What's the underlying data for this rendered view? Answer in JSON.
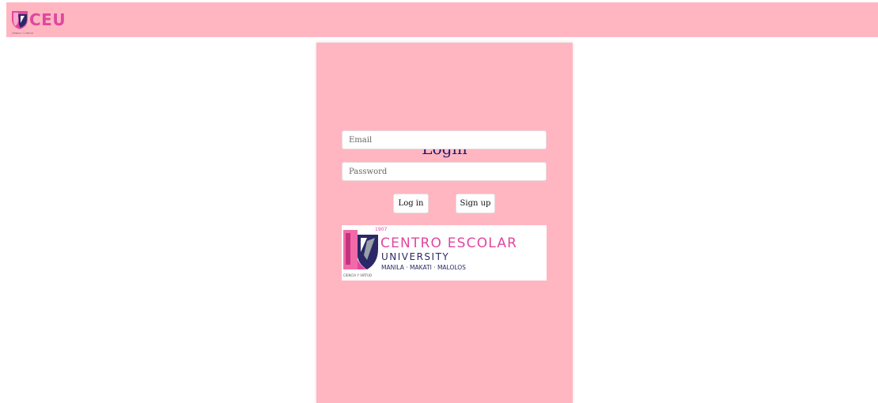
{
  "navbar": {
    "logo_text": "CEU",
    "logo_motto": "CIENCIA Y VIRTUD",
    "logo_icon": "ceu-shield-icon"
  },
  "login": {
    "title": "Login",
    "email_placeholder": "Email",
    "email_value": "",
    "password_placeholder": "Password",
    "password_value": "",
    "login_button": "Log in",
    "signup_button": "Sign up"
  },
  "banner": {
    "year": "1907",
    "name": "CENTRO ESCOLAR",
    "university": "UNIVERSITY",
    "campuses": "MANILA · MAKATI · MALOLOS",
    "motto": "CIENCIA Y VIRTUD"
  },
  "colors": {
    "background": "#ffffff",
    "panel_pink": "#ffb6c1",
    "brand_magenta": "#e0479e",
    "brand_navy": "#2a2866",
    "title_navy": "#1f1a6e"
  }
}
